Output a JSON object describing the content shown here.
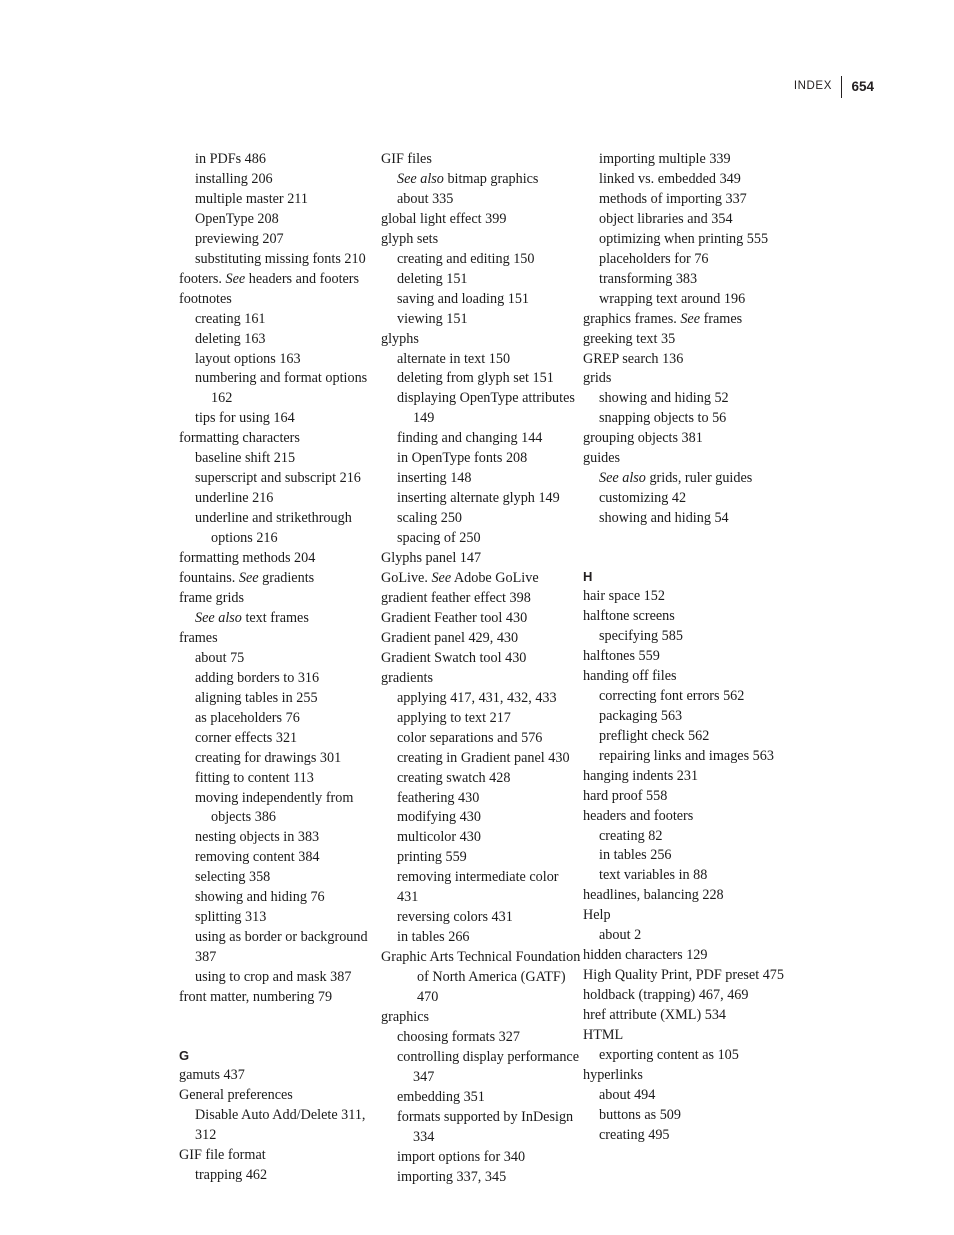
{
  "header": {
    "label": "INDEX",
    "folio": "654",
    "rule_color": "#231f20"
  },
  "page": {
    "background": "#ffffff",
    "text_color": "#1a1a1a"
  },
  "columns": [
    {
      "id": "column-1",
      "entries": [
        {
          "level": 2,
          "text": "in PDFs 486"
        },
        {
          "level": 2,
          "text": "installing 206"
        },
        {
          "level": 2,
          "text": "multiple master 211"
        },
        {
          "level": 2,
          "text": "OpenType 208"
        },
        {
          "level": 2,
          "text": "previewing 207"
        },
        {
          "level": 2,
          "text": "substituting missing fonts 210"
        },
        {
          "level": 1,
          "text": "footers. See headers and footers",
          "italic": "See"
        },
        {
          "level": 1,
          "text": "footnotes"
        },
        {
          "level": 2,
          "text": "creating 161"
        },
        {
          "level": 2,
          "text": "deleting 163"
        },
        {
          "level": 2,
          "text": "layout options 163"
        },
        {
          "level": 2,
          "text": "numbering and format options 162",
          "wrap": true
        },
        {
          "level": 2,
          "text": "tips for using 164"
        },
        {
          "level": 1,
          "text": "formatting characters"
        },
        {
          "level": 2,
          "text": "baseline shift 215"
        },
        {
          "level": 2,
          "text": "superscript and subscript 216"
        },
        {
          "level": 2,
          "text": "underline 216"
        },
        {
          "level": 2,
          "text": "underline and strikethrough options 216",
          "wrap": true
        },
        {
          "level": 1,
          "text": "formatting methods 204"
        },
        {
          "level": 1,
          "text": "fountains. See gradients",
          "italic": "See"
        },
        {
          "level": 1,
          "text": "frame grids"
        },
        {
          "level": 2,
          "text": "See also text frames",
          "italic": "See also"
        },
        {
          "level": 1,
          "text": "frames"
        },
        {
          "level": 2,
          "text": "about 75"
        },
        {
          "level": 2,
          "text": "adding borders to 316"
        },
        {
          "level": 2,
          "text": "aligning tables in 255"
        },
        {
          "level": 2,
          "text": "as placeholders 76"
        },
        {
          "level": 2,
          "text": "corner effects 321"
        },
        {
          "level": 2,
          "text": "creating for drawings 301"
        },
        {
          "level": 2,
          "text": "fitting to content 113"
        },
        {
          "level": 2,
          "text": "moving independently from objects 386",
          "wrap": true
        },
        {
          "level": 2,
          "text": "nesting objects in 383"
        },
        {
          "level": 2,
          "text": "removing content 384"
        },
        {
          "level": 2,
          "text": "selecting 358"
        },
        {
          "level": 2,
          "text": "showing and hiding 76"
        },
        {
          "level": 2,
          "text": "splitting 313"
        },
        {
          "level": 2,
          "text": "using as border or background 387"
        },
        {
          "level": 2,
          "text": "using to crop and mask 387"
        },
        {
          "level": 1,
          "text": "front matter, numbering 79"
        },
        {
          "section_gap": true
        },
        {
          "section": "G"
        },
        {
          "level": 1,
          "text": "gamuts 437"
        },
        {
          "level": 1,
          "text": "General preferences"
        },
        {
          "level": 2,
          "text": "Disable Auto Add/Delete 311, 312"
        },
        {
          "level": 1,
          "text": "GIF file format"
        },
        {
          "level": 2,
          "text": "trapping 462"
        }
      ]
    },
    {
      "id": "column-2",
      "entries": [
        {
          "level": 1,
          "text": "GIF files"
        },
        {
          "level": 2,
          "text": "See also bitmap graphics",
          "italic": "See also"
        },
        {
          "level": 2,
          "text": "about 335"
        },
        {
          "level": 1,
          "text": "global light effect 399"
        },
        {
          "level": 1,
          "text": "glyph sets"
        },
        {
          "level": 2,
          "text": "creating and editing 150"
        },
        {
          "level": 2,
          "text": "deleting 151"
        },
        {
          "level": 2,
          "text": "saving and loading 151"
        },
        {
          "level": 2,
          "text": "viewing 151"
        },
        {
          "level": 1,
          "text": "glyphs"
        },
        {
          "level": 2,
          "text": "alternate in text 150"
        },
        {
          "level": 2,
          "text": "deleting from glyph set 151"
        },
        {
          "level": 2,
          "text": "displaying OpenType attributes 149",
          "wrap": true
        },
        {
          "level": 2,
          "text": "finding and changing 144"
        },
        {
          "level": 2,
          "text": "in OpenType fonts 208"
        },
        {
          "level": 2,
          "text": "inserting 148"
        },
        {
          "level": 2,
          "text": "inserting alternate glyph 149"
        },
        {
          "level": 2,
          "text": "scaling 250"
        },
        {
          "level": 2,
          "text": "spacing of 250"
        },
        {
          "level": 1,
          "text": "Glyphs panel 147"
        },
        {
          "level": 1,
          "text": "GoLive. See Adobe GoLive",
          "italic": "See"
        },
        {
          "level": 1,
          "text": "gradient feather effect 398"
        },
        {
          "level": 1,
          "text": "Gradient Feather tool 430"
        },
        {
          "level": 1,
          "text": "Gradient panel 429, 430"
        },
        {
          "level": 1,
          "text": "Gradient Swatch tool 430"
        },
        {
          "level": 1,
          "text": "gradients"
        },
        {
          "level": 2,
          "text": "applying 417, 431, 432, 433"
        },
        {
          "level": 2,
          "text": "applying to text 217"
        },
        {
          "level": 2,
          "text": "color separations and 576"
        },
        {
          "level": 2,
          "text": "creating in Gradient panel 430"
        },
        {
          "level": 2,
          "text": "creating swatch 428"
        },
        {
          "level": 2,
          "text": "feathering 430"
        },
        {
          "level": 2,
          "text": "modifying 430"
        },
        {
          "level": 2,
          "text": "multicolor 430"
        },
        {
          "level": 2,
          "text": "printing 559"
        },
        {
          "level": 2,
          "text": "removing intermediate color 431"
        },
        {
          "level": 2,
          "text": "reversing colors 431"
        },
        {
          "level": 2,
          "text": "in tables 266"
        },
        {
          "level": 1,
          "text": "Graphic Arts Technical Foundation of North America (GATF) 470",
          "wrap_deep": true
        },
        {
          "level": 1,
          "text": "graphics"
        },
        {
          "level": 2,
          "text": "choosing formats 327"
        },
        {
          "level": 2,
          "text": "controlling display performance 347",
          "wrap": true
        },
        {
          "level": 2,
          "text": "embedding 351"
        },
        {
          "level": 2,
          "text": "formats supported by InDesign 334",
          "wrap": true
        },
        {
          "level": 2,
          "text": "import options for 340"
        },
        {
          "level": 2,
          "text": "importing 337, 345"
        }
      ]
    },
    {
      "id": "column-3",
      "entries": [
        {
          "level": 2,
          "text": "importing multiple 339"
        },
        {
          "level": 2,
          "text": "linked vs. embedded 349"
        },
        {
          "level": 2,
          "text": "methods of importing 337"
        },
        {
          "level": 2,
          "text": "object libraries and 354"
        },
        {
          "level": 2,
          "text": "optimizing when printing 555"
        },
        {
          "level": 2,
          "text": "placeholders for 76"
        },
        {
          "level": 2,
          "text": "transforming 383"
        },
        {
          "level": 2,
          "text": "wrapping text around 196"
        },
        {
          "level": 1,
          "text": "graphics frames. See frames",
          "italic": "See"
        },
        {
          "level": 1,
          "text": "greeking text 35"
        },
        {
          "level": 1,
          "text": "GREP search 136"
        },
        {
          "level": 1,
          "text": "grids"
        },
        {
          "level": 2,
          "text": "showing and hiding 52"
        },
        {
          "level": 2,
          "text": "snapping objects to 56"
        },
        {
          "level": 1,
          "text": "grouping objects 381"
        },
        {
          "level": 1,
          "text": "guides"
        },
        {
          "level": 2,
          "text": "See also grids, ruler guides",
          "italic": "See also"
        },
        {
          "level": 2,
          "text": "customizing 42"
        },
        {
          "level": 2,
          "text": "showing and hiding 54"
        },
        {
          "section_gap": true
        },
        {
          "section": "H"
        },
        {
          "level": 1,
          "text": "hair space 152"
        },
        {
          "level": 1,
          "text": "halftone screens"
        },
        {
          "level": 2,
          "text": "specifying 585"
        },
        {
          "level": 1,
          "text": "halftones 559"
        },
        {
          "level": 1,
          "text": "handing off files"
        },
        {
          "level": 2,
          "text": "correcting font errors 562"
        },
        {
          "level": 2,
          "text": "packaging 563"
        },
        {
          "level": 2,
          "text": "preflight check 562"
        },
        {
          "level": 2,
          "text": "repairing links and images 563"
        },
        {
          "level": 1,
          "text": "hanging indents 231"
        },
        {
          "level": 1,
          "text": "hard proof 558"
        },
        {
          "level": 1,
          "text": "headers and footers"
        },
        {
          "level": 2,
          "text": "creating 82"
        },
        {
          "level": 2,
          "text": "in tables 256"
        },
        {
          "level": 2,
          "text": "text variables in 88"
        },
        {
          "level": 1,
          "text": "headlines, balancing 228"
        },
        {
          "level": 1,
          "text": "Help"
        },
        {
          "level": 2,
          "text": "about 2"
        },
        {
          "level": 1,
          "text": "hidden characters 129"
        },
        {
          "level": 1,
          "text": "High Quality Print, PDF preset 475"
        },
        {
          "level": 1,
          "text": "holdback (trapping) 467, 469"
        },
        {
          "level": 1,
          "text": "href attribute (XML) 534"
        },
        {
          "level": 1,
          "text": "HTML"
        },
        {
          "level": 2,
          "text": "exporting content as 105"
        },
        {
          "level": 1,
          "text": "hyperlinks"
        },
        {
          "level": 2,
          "text": "about 494"
        },
        {
          "level": 2,
          "text": "buttons as 509"
        },
        {
          "level": 2,
          "text": "creating 495"
        }
      ]
    }
  ]
}
